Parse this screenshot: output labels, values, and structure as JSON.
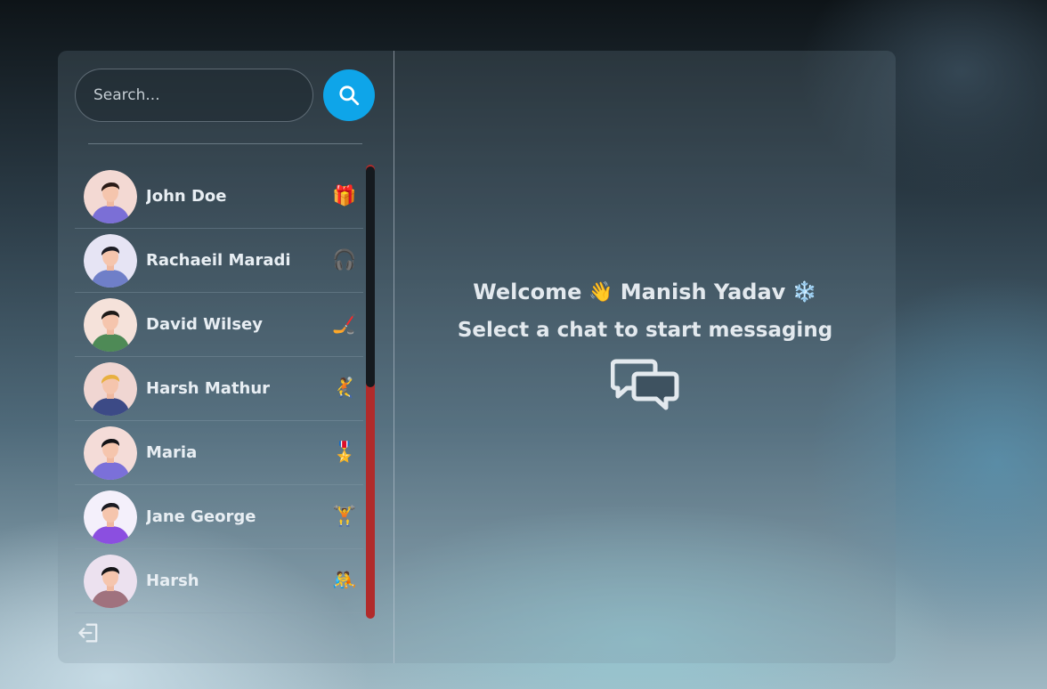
{
  "search": {
    "placeholder": "Search..."
  },
  "conversations": [
    {
      "name": "John Doe",
      "emoji": "🎁",
      "avatar_bg": "#f3d9d3",
      "shirt": "#7b6fd6",
      "hair": "#2a1b17"
    },
    {
      "name": "Rachaeil Maradi",
      "emoji": "🎧",
      "avatar_bg": "#e6e4f4",
      "shirt": "#6f7fc8",
      "hair": "#1c1c25"
    },
    {
      "name": "David Wilsey",
      "emoji": "🏒",
      "avatar_bg": "#f5e2da",
      "shirt": "#4e8a56",
      "hair": "#1d1a18"
    },
    {
      "name": "Harsh Mathur",
      "emoji": "🤾",
      "avatar_bg": "#f0d6d2",
      "shirt": "#3c4a86",
      "hair": "#e8b040"
    },
    {
      "name": "Maria",
      "emoji": "🎖️",
      "avatar_bg": "#f4dcd8",
      "shirt": "#7b70d9",
      "hair": "#121216"
    },
    {
      "name": "Jane George",
      "emoji": "🏋️",
      "avatar_bg": "#f4f0fb",
      "shirt": "#8b4fe0",
      "hair": "#1a1a22"
    },
    {
      "name": "Harsh",
      "emoji": "🤼",
      "avatar_bg": "#ece1ef",
      "shirt": "#a0727e",
      "hair": "#151518"
    }
  ],
  "welcome": {
    "prefix": "Welcome",
    "wave_emoji": "👋",
    "user_name": "Manish Yadav",
    "snow_emoji": "❄️",
    "subtitle": "Select a chat to start messaging"
  },
  "icons": {
    "search_button": "search-icon",
    "logout": "logout-icon",
    "chat": "chat-bubbles-icon"
  },
  "colors": {
    "accent": "#0ea5e9",
    "scrollbar_track": "#b12b2b",
    "scrollbar_thumb": "#151a1f"
  }
}
